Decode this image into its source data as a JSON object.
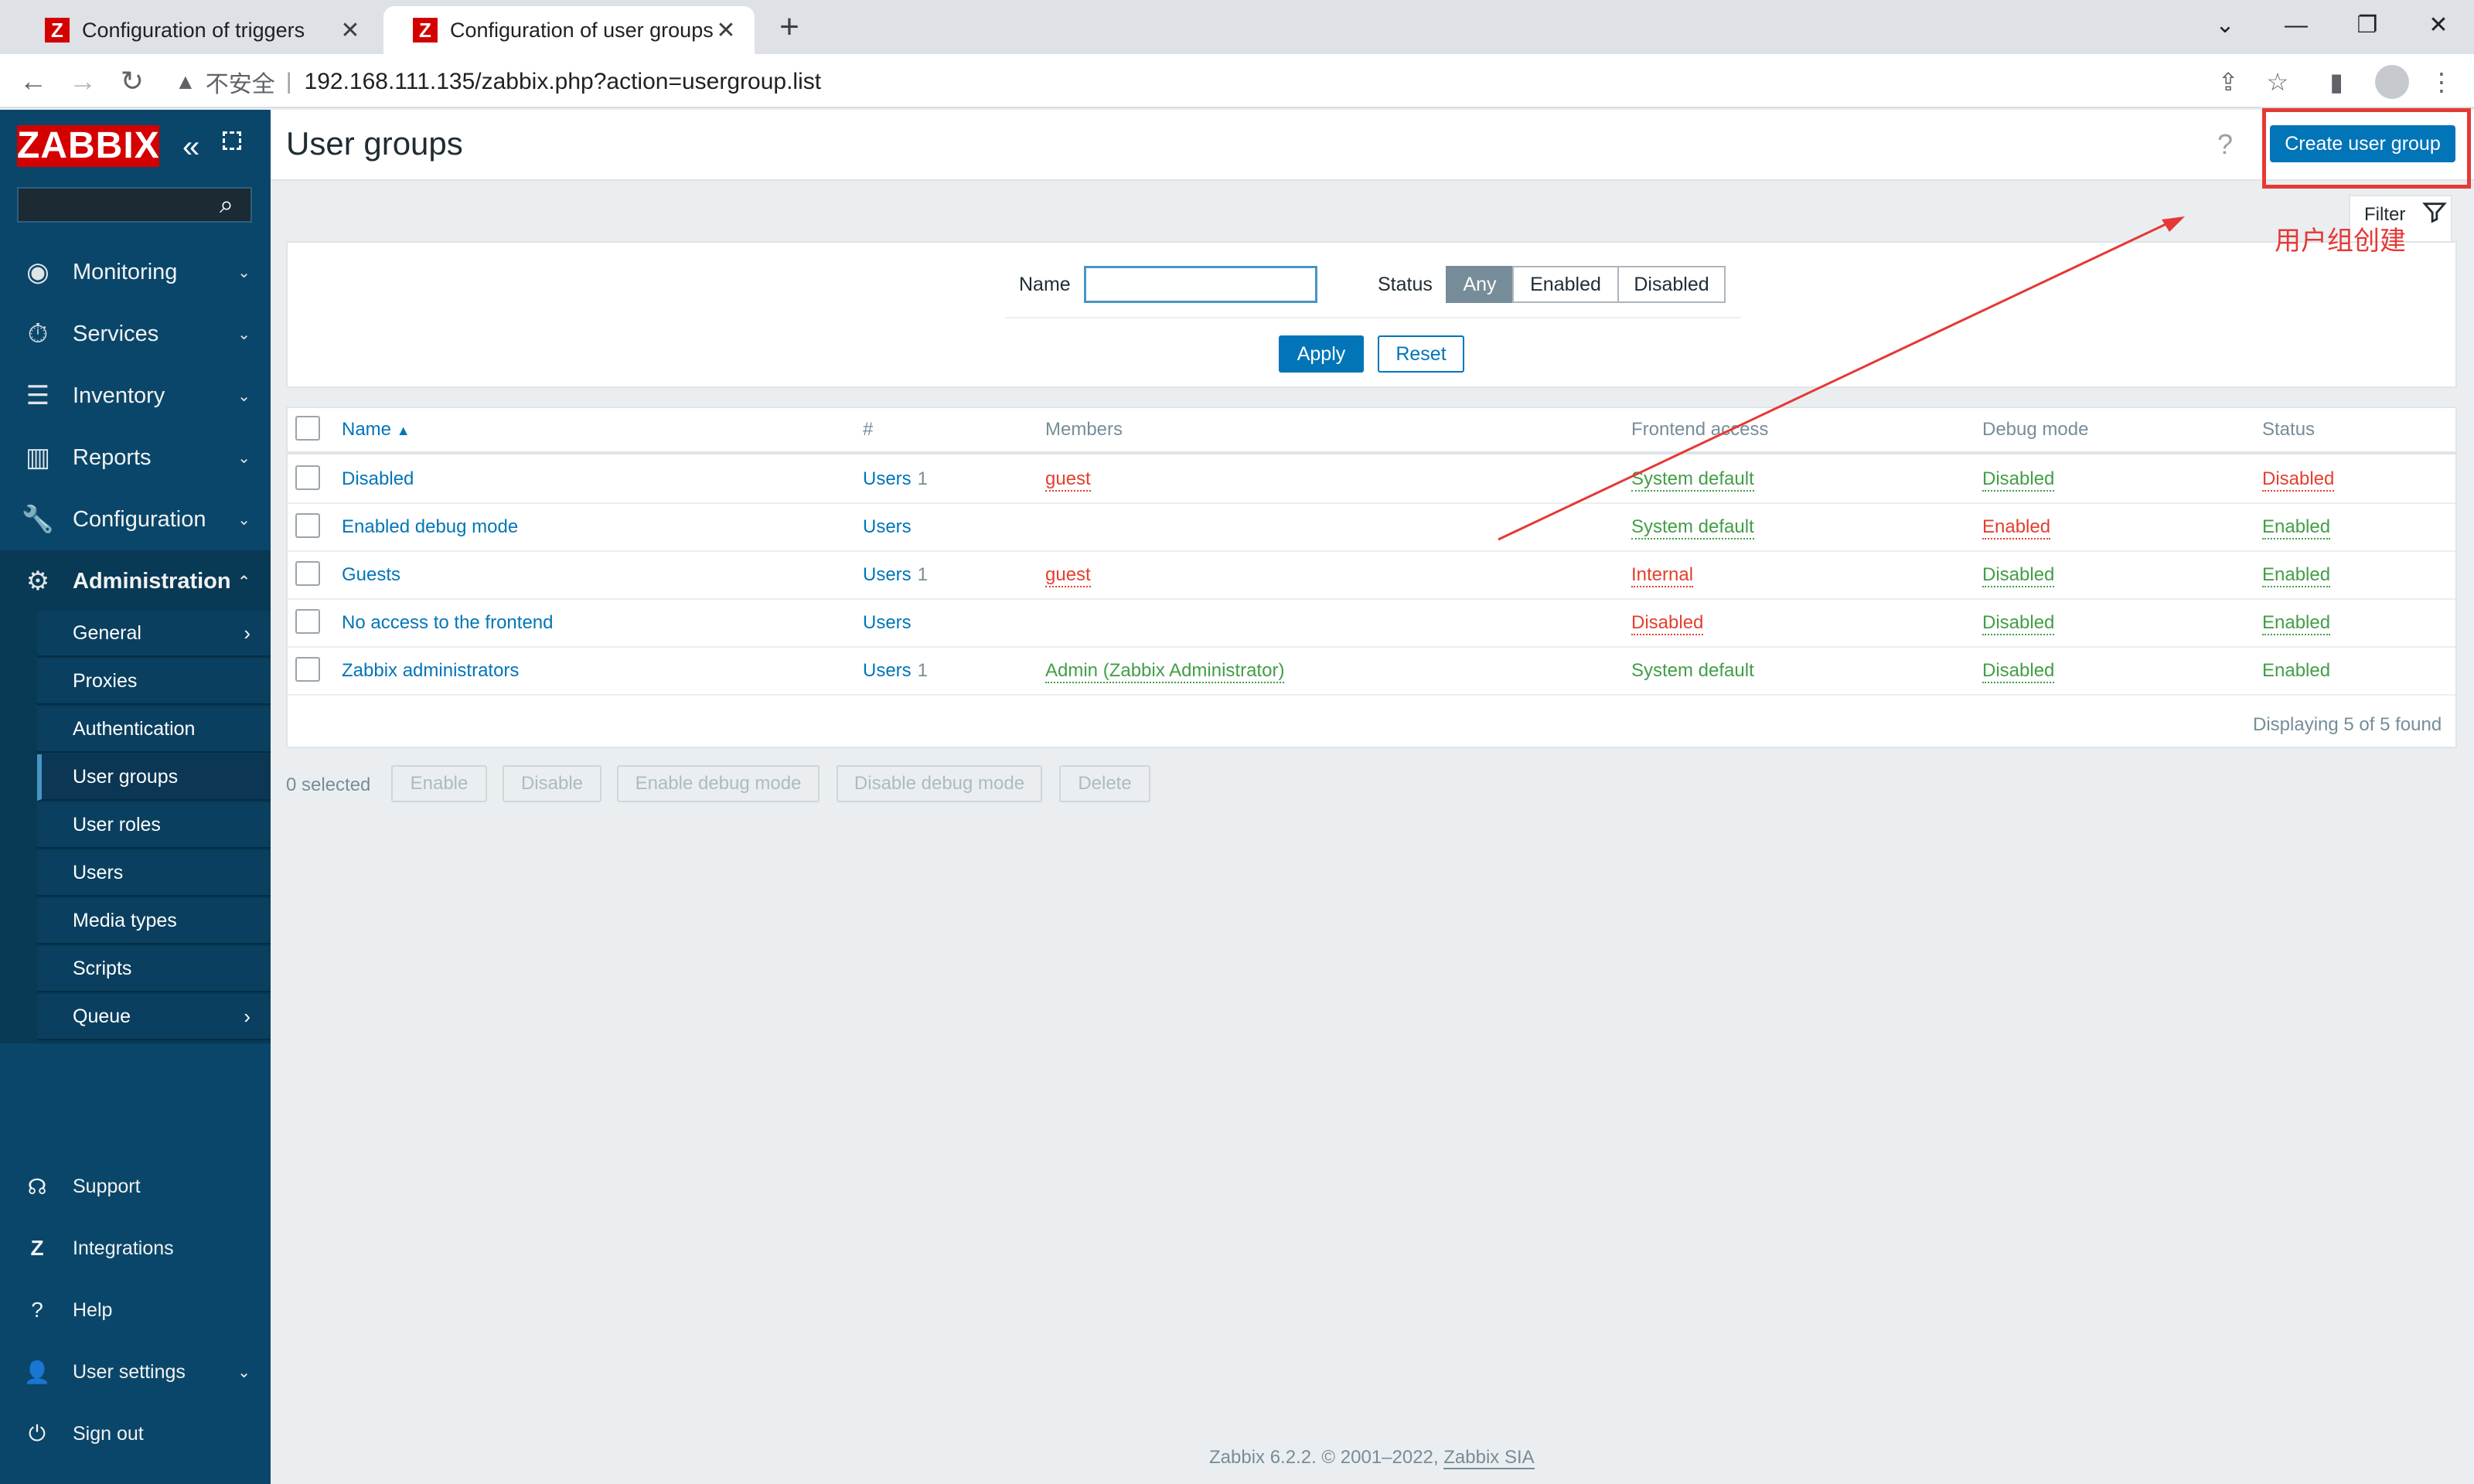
{
  "browser": {
    "tabs": [
      {
        "title": "Configuration of triggers",
        "favicon": "Z"
      },
      {
        "title": "Configuration of user groups",
        "favicon": "Z"
      }
    ],
    "url": "192.168.111.135/zabbix.php?action=usergroup.list",
    "security_label": "不安全"
  },
  "sidebar": {
    "logo": "ZABBIX",
    "menu": [
      {
        "label": "Monitoring",
        "icon": "eye-icon"
      },
      {
        "label": "Services",
        "icon": "stopwatch-icon"
      },
      {
        "label": "Inventory",
        "icon": "list-icon"
      },
      {
        "label": "Reports",
        "icon": "bar-chart-icon"
      },
      {
        "label": "Configuration",
        "icon": "wrench-icon"
      },
      {
        "label": "Administration",
        "icon": "gear-icon"
      }
    ],
    "submenu": [
      "General",
      "Proxies",
      "Authentication",
      "User groups",
      "User roles",
      "Users",
      "Media types",
      "Scripts",
      "Queue"
    ],
    "bottom": [
      {
        "label": "Support",
        "icon": "headset-icon"
      },
      {
        "label": "Integrations",
        "icon": "zabbix-icon"
      },
      {
        "label": "Help",
        "icon": "question-icon"
      },
      {
        "label": "User settings",
        "icon": "user-icon"
      },
      {
        "label": "Sign out",
        "icon": "power-icon"
      }
    ]
  },
  "header": {
    "title": "User groups",
    "create_button": "Create user group",
    "help": "?"
  },
  "filter": {
    "tab_label": "Filter",
    "name_label": "Name",
    "name_value": "",
    "status_label": "Status",
    "status_options": [
      "Any",
      "Enabled",
      "Disabled"
    ],
    "status_selected": "Any",
    "apply": "Apply",
    "reset": "Reset"
  },
  "table": {
    "headers": [
      "Name",
      "#",
      "Members",
      "Frontend access",
      "Debug mode",
      "Status"
    ],
    "sort_indicator": "▲",
    "rows": [
      {
        "name": "Disabled",
        "users": "Users",
        "count": "1",
        "members": "guest",
        "frontend": "System default",
        "debug": "Disabled",
        "status": "Disabled"
      },
      {
        "name": "Enabled debug mode",
        "users": "Users",
        "count": "",
        "members": "",
        "frontend": "System default",
        "debug": "Enabled",
        "status": "Enabled"
      },
      {
        "name": "Guests",
        "users": "Users",
        "count": "1",
        "members": "guest",
        "frontend": "Internal",
        "debug": "Disabled",
        "status": "Enabled"
      },
      {
        "name": "No access to the frontend",
        "users": "Users",
        "count": "",
        "members": "",
        "frontend": "Disabled",
        "debug": "Disabled",
        "status": "Enabled"
      },
      {
        "name": "Zabbix administrators",
        "users": "Users",
        "count": "1",
        "members": "Admin (Zabbix Administrator)",
        "frontend": "System default",
        "debug": "Disabled",
        "status": "Enabled"
      }
    ],
    "displaying": "Displaying 5 of 5 found"
  },
  "actions": {
    "selected": "0 selected",
    "buttons": [
      "Enable",
      "Disable",
      "Enable debug mode",
      "Disable debug mode",
      "Delete"
    ]
  },
  "footer": {
    "text": "Zabbix 6.2.2. © 2001–2022, ",
    "link": "Zabbix SIA"
  },
  "annotation": {
    "text": "用户组创建",
    "color": "#e53935"
  },
  "colors": {
    "sidebar": "#0a466a",
    "primary": "#0275b8",
    "red": "#e53f2e",
    "green": "#429e47"
  }
}
